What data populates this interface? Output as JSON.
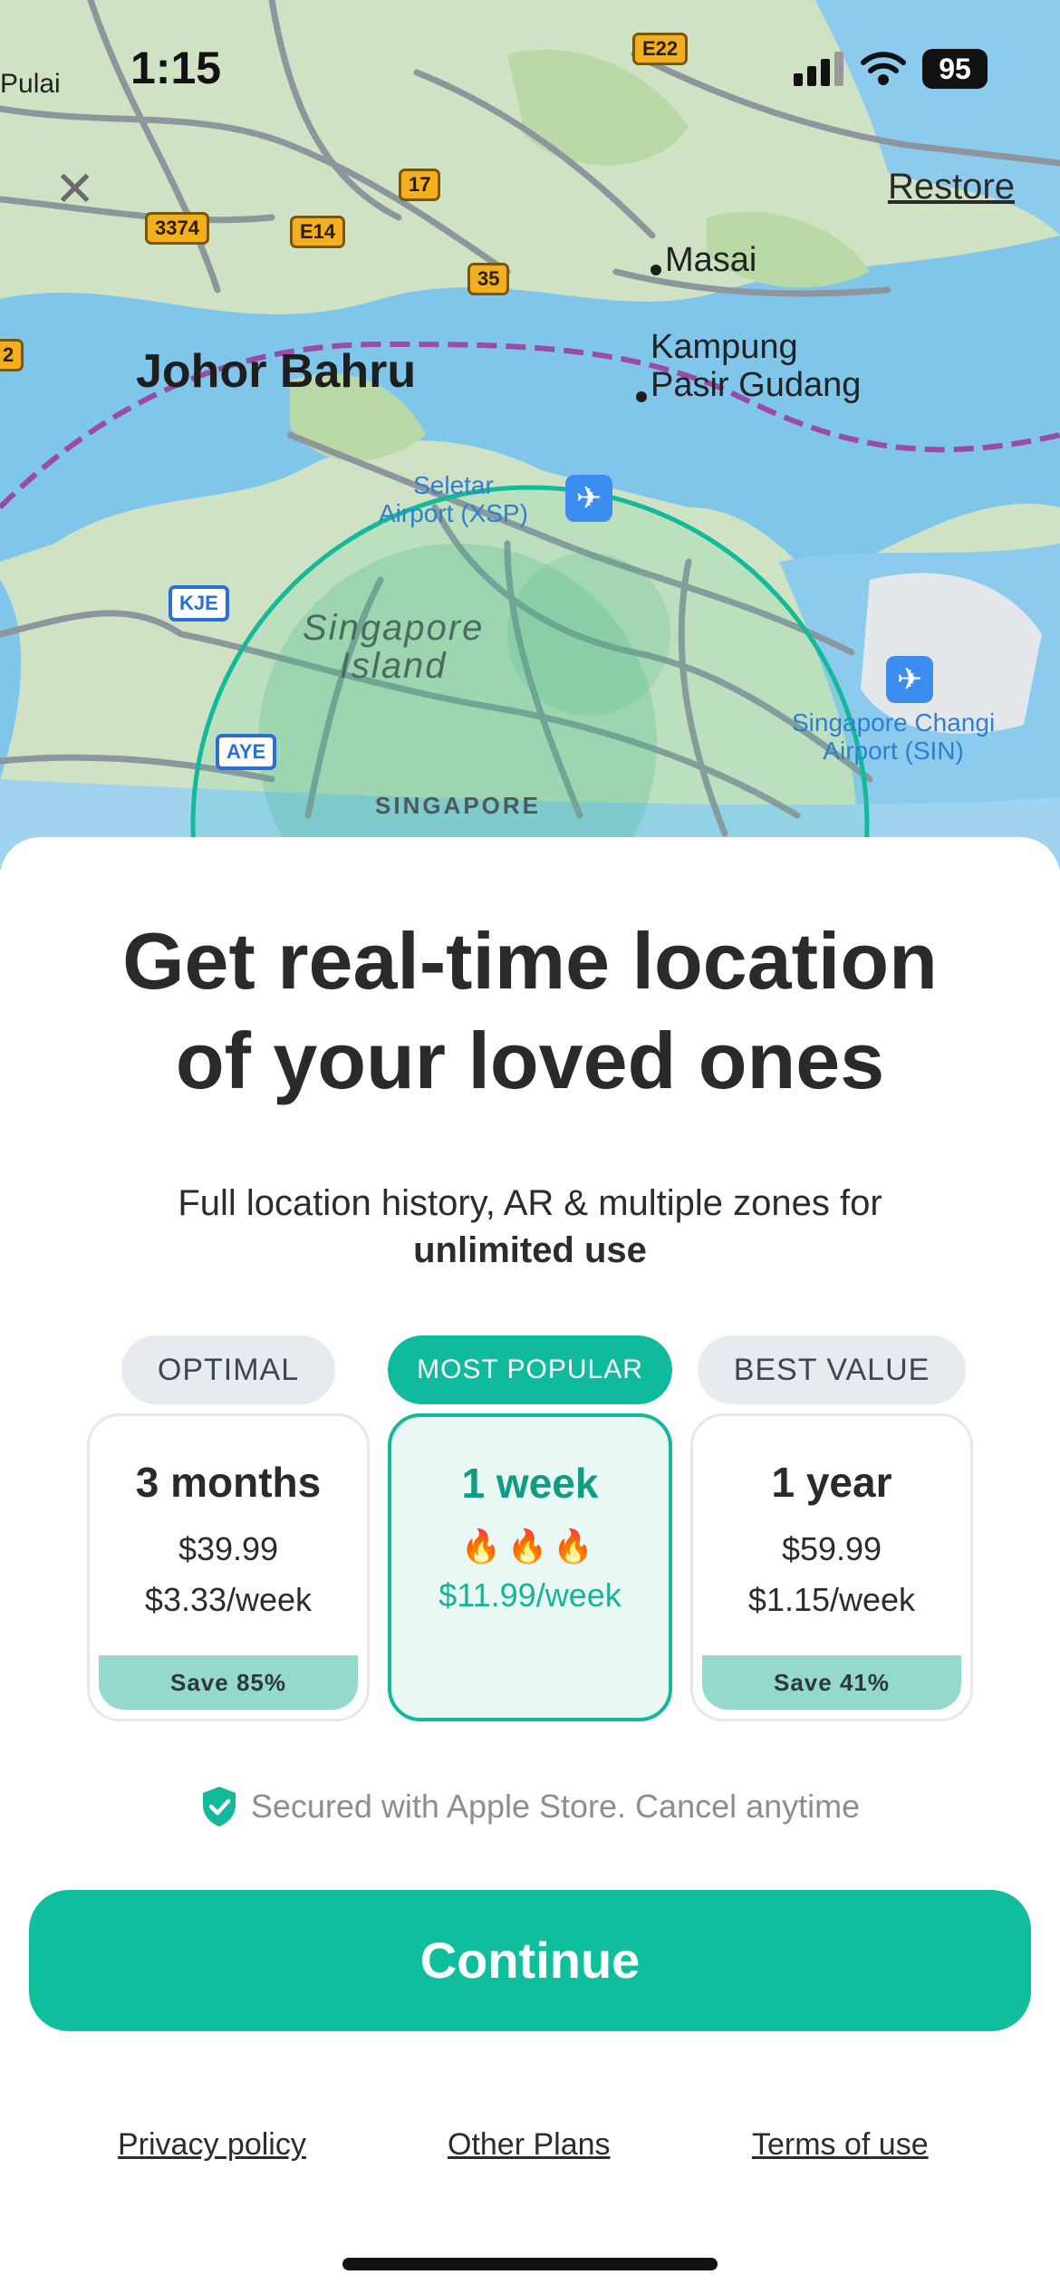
{
  "status_bar": {
    "time": "1:15",
    "battery": "95"
  },
  "map": {
    "labels": {
      "pulai": "Pulai",
      "johor_bahru": "Johor Bahru",
      "masai": "Masai",
      "kampung_line1": "Kampung",
      "kampung_line2": "Pasir Gudang",
      "seletar_line1": "Seletar",
      "seletar_line2": "Airport (XSP)",
      "island_line1": "Singapore",
      "island_line2": "Island",
      "country": "SINGAPORE",
      "changi_line1": "Singapore Changi",
      "changi_line2": "Airport (SIN)"
    },
    "road_badges": [
      "E22",
      "17",
      "3374",
      "E14",
      "35",
      "2"
    ],
    "highway_badges": [
      "KJE",
      "AYE"
    ],
    "colors": {
      "land": "#cfe3c4",
      "water": "#7fc6ea",
      "ring": "#13b99b"
    }
  },
  "header": {
    "close_icon": "close-icon",
    "restore_label": "Restore"
  },
  "paywall": {
    "headline_line1": "Get real-time location",
    "headline_line2": "of your loved ones",
    "sub_line1": "Full location history, AR & multiple zones for",
    "sub_line2": "unlimited use",
    "tags": [
      "OPTIMAL",
      "MOST POPULAR",
      "BEST VALUE"
    ],
    "plans": [
      {
        "duration": "3 months",
        "price": "$39.99",
        "weekly": "$3.33/week",
        "save": "Save 85%"
      },
      {
        "duration": "1 week",
        "fire": "🔥🔥🔥",
        "weekly": "$11.99/week",
        "selected": true
      },
      {
        "duration": "1 year",
        "price": "$59.99",
        "weekly": "$1.15/week",
        "save": "Save 41%"
      }
    ],
    "secure_text": "Secured with Apple Store. Cancel anytime",
    "continue_label": "Continue",
    "links": {
      "privacy": "Privacy policy",
      "other": "Other Plans",
      "terms": "Terms of use"
    },
    "accent": "#0fbe9d"
  }
}
